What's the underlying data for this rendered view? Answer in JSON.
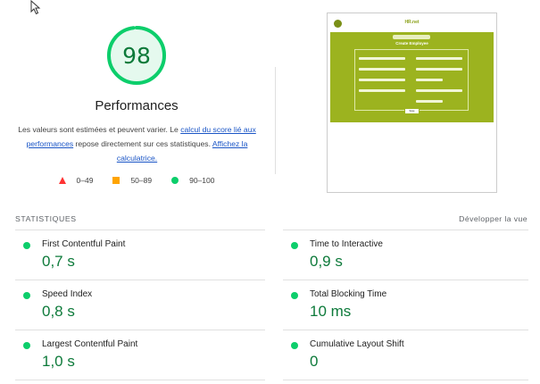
{
  "score": {
    "value": "98",
    "label": "Performances",
    "fraction": 0.98,
    "color": "#0cce6b"
  },
  "description": {
    "text1": "Les valeurs sont estimées et peuvent varier. Le ",
    "link1": "calcul du score lié aux performances",
    "text2": " repose directement sur ces statistiques. ",
    "link2": "Affichez la calculatrice."
  },
  "legend": [
    {
      "range": "0–49",
      "icon": "red-triangle-icon"
    },
    {
      "range": "50–89",
      "icon": "orange-square-icon"
    },
    {
      "range": "90–100",
      "icon": "green-circle-icon"
    }
  ],
  "thumbnail": {
    "site_title": "HR.net",
    "page_title": "Create Employee",
    "button": "Save"
  },
  "statistics": {
    "heading": "STATISTIQUES",
    "expand_label": "Développer la vue",
    "metrics": [
      {
        "name": "First Contentful Paint",
        "value": "0,7 s"
      },
      {
        "name": "Time to Interactive",
        "value": "0,9 s"
      },
      {
        "name": "Speed Index",
        "value": "0,8 s"
      },
      {
        "name": "Total Blocking Time",
        "value": "10 ms"
      },
      {
        "name": "Largest Contentful Paint",
        "value": "1,0 s"
      },
      {
        "name": "Cumulative Layout Shift",
        "value": "0"
      }
    ]
  },
  "colors": {
    "pass": "#0cce6b",
    "pass_text": "#0d7a3a",
    "average": "#ffa400",
    "fail": "#ff3333",
    "link": "#1a55c6"
  }
}
